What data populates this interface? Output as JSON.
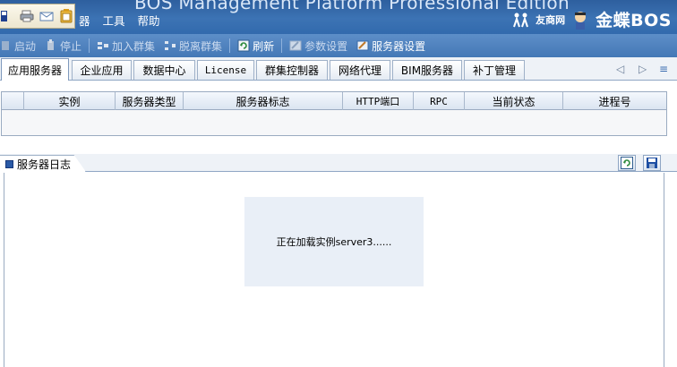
{
  "window": {
    "title": "BOS Management Platform Professional Edition"
  },
  "menu": {
    "items": [
      "器",
      "工具",
      "帮助"
    ]
  },
  "brand": {
    "partner": "友商网",
    "product": "金蝶BOS"
  },
  "toolbar": {
    "buttons": [
      {
        "label": "启动",
        "icon": "play-icon"
      },
      {
        "label": "停止",
        "icon": "stop-icon"
      },
      {
        "label": "加入群集",
        "icon": "join-cluster-icon"
      },
      {
        "label": "脱离群集",
        "icon": "leave-cluster-icon"
      },
      {
        "label": "刷新",
        "icon": "refresh-icon"
      },
      {
        "label": "参数设置",
        "icon": "params-icon"
      },
      {
        "label": "服务器设置",
        "icon": "server-settings-icon"
      }
    ]
  },
  "tabs": [
    "应用服务器",
    "企业应用",
    "数据中心",
    "License",
    "群集控制器",
    "网络代理",
    "BIM服务器",
    "补丁管理"
  ],
  "table": {
    "columns": [
      "",
      "实例",
      "服务器类型",
      "服务器标志",
      "HTTP端口",
      "RPC",
      "当前状态",
      "进程号"
    ]
  },
  "log": {
    "title": "服务器日志"
  },
  "loading": {
    "message": "正在加载实例server3......"
  },
  "colors": {
    "titlebar": "#3c73b4",
    "toolbar": "#4f82c0",
    "loading_bg": "#e9eff7"
  }
}
